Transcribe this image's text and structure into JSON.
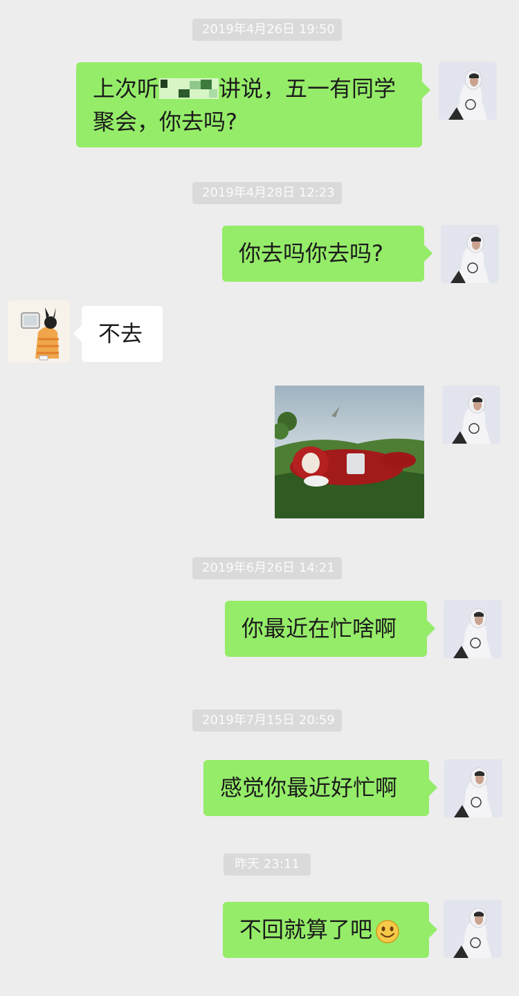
{
  "chat": {
    "timestamps": [
      "2019年4月26日 19:50",
      "2019年4月28日 12:23",
      "2019年6月26日 14:21",
      "2019年7月15日  20:59",
      "昨天  23:11"
    ],
    "messages": [
      {
        "from": "me",
        "text_before": "上次听",
        "text_after": "讲说，五一有同学聚会，你去吗?"
      },
      {
        "from": "me",
        "text": "你去吗你去吗?"
      },
      {
        "from": "other",
        "text": "不去"
      },
      {
        "from": "me",
        "type": "image",
        "image_name": "teletubby-lying-on-grass"
      },
      {
        "from": "me",
        "text": "你最近在忙啥啊"
      },
      {
        "from": "me",
        "text": "感觉你最近好忙啊"
      },
      {
        "from": "me",
        "text": "不回就算了吧",
        "emoji": "smile-emoji"
      }
    ]
  },
  "colors": {
    "background": "#ededed",
    "my_bubble": "#95ec69",
    "other_bubble": "#ffffff",
    "timestamp_bg": "#dadada"
  }
}
